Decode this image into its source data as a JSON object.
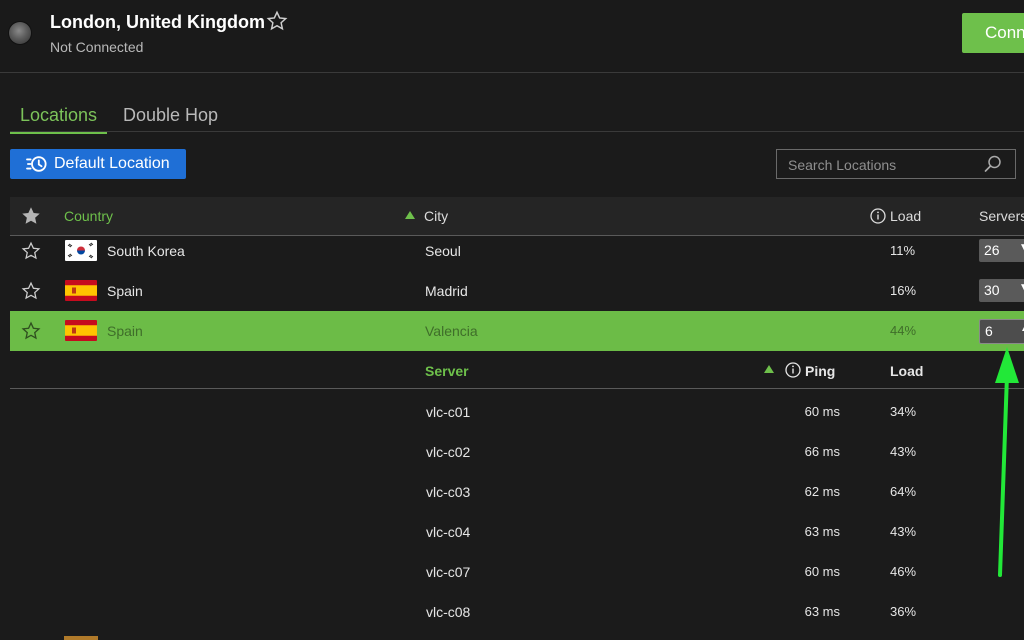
{
  "header": {
    "location_title": "London, United Kingdom",
    "status": "Not Connected",
    "connect_label": "Connect"
  },
  "tabs": [
    {
      "label": "Locations",
      "active": true
    },
    {
      "label": "Double Hop",
      "active": false
    }
  ],
  "toolbar": {
    "default_location_label": "Default Location",
    "search_placeholder": "Search Locations"
  },
  "table": {
    "columns": {
      "country": "Country",
      "city": "City",
      "load": "Load",
      "servers": "Servers"
    },
    "rows": [
      {
        "country": "South Korea",
        "flag": "kr-flag-icon",
        "city": "Seoul",
        "load": "11%",
        "servers": "26",
        "expanded": false
      },
      {
        "country": "Spain",
        "flag": "es-flag-icon",
        "city": "Madrid",
        "load": "16%",
        "servers": "30",
        "expanded": false
      },
      {
        "country": "Spain",
        "flag": "es-flag-icon",
        "city": "Valencia",
        "load": "44%",
        "servers": "6",
        "expanded": true
      }
    ]
  },
  "server_table": {
    "columns": {
      "server": "Server",
      "ping": "Ping",
      "load": "Load"
    },
    "rows": [
      {
        "name": "vlc-c01",
        "ping": "60 ms",
        "load": "34%"
      },
      {
        "name": "vlc-c02",
        "ping": "66 ms",
        "load": "43%"
      },
      {
        "name": "vlc-c03",
        "ping": "62 ms",
        "load": "64%"
      },
      {
        "name": "vlc-c04",
        "ping": "63 ms",
        "load": "43%"
      },
      {
        "name": "vlc-c07",
        "ping": "60 ms",
        "load": "46%"
      },
      {
        "name": "vlc-c08",
        "ping": "63 ms",
        "load": "36%"
      }
    ]
  },
  "colors": {
    "accent_green": "#6ec04b",
    "selected_row": "#6cbc47",
    "default_button_blue": "#1f6fd6",
    "background": "#1b1b1b"
  },
  "icons": [
    "status-indicator-icon",
    "star-outline-icon",
    "star-filled-icon",
    "clock-restore-icon",
    "search-icon",
    "sort-ascending-icon",
    "info-icon",
    "chevron-down-icon",
    "chevron-up-icon",
    "annotation-arrow-icon"
  ]
}
